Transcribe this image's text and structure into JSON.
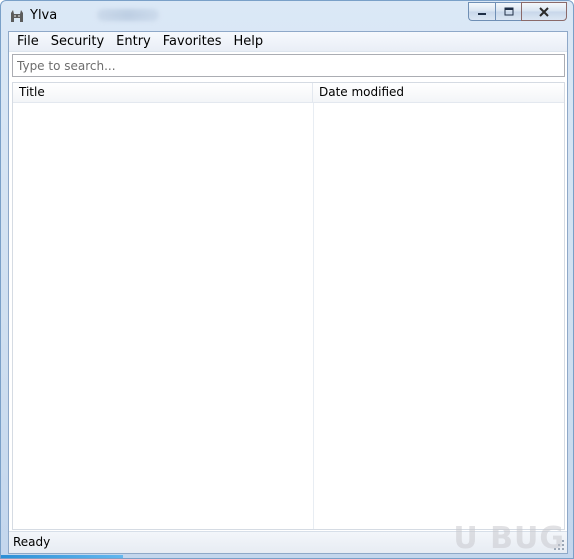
{
  "window": {
    "title": "Ylva",
    "icon": "ylva-cat-icon"
  },
  "caption": {
    "minimize_icon": "minimize-icon",
    "maximize_icon": "maximize-icon",
    "close_icon": "close-icon"
  },
  "menu": {
    "items": [
      {
        "label": "File"
      },
      {
        "label": "Security"
      },
      {
        "label": "Entry"
      },
      {
        "label": "Favorites"
      },
      {
        "label": "Help"
      }
    ]
  },
  "search": {
    "placeholder": "Type to search...",
    "value": ""
  },
  "list": {
    "columns": [
      {
        "label": "Title"
      },
      {
        "label": "Date modified"
      }
    ],
    "rows": []
  },
  "status": {
    "text": "Ready"
  },
  "colors": {
    "accent": "#2b8fd6",
    "window_frame": "#c3d6ed"
  },
  "watermark": {
    "text": "U BUG",
    "sub": "U BUG"
  }
}
